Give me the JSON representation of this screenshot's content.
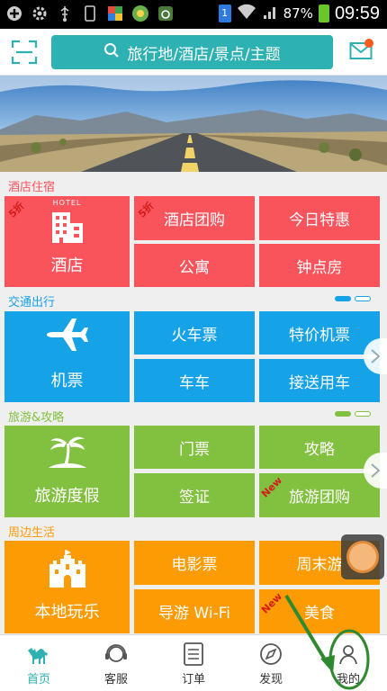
{
  "status_bar": {
    "battery_pct": "87%",
    "time": "09:59",
    "sim_badge": "1"
  },
  "header": {
    "search_placeholder": "旅行地/酒店/景点/主题"
  },
  "sections": {
    "hotel": {
      "title": "酒店住宿",
      "main": "酒店",
      "main_caption": "HOTEL",
      "main_badge": "5折",
      "items": [
        "酒店团购",
        "今日特惠",
        "公寓",
        "钟点房"
      ],
      "item_badge": "5折"
    },
    "transport": {
      "title": "交通出行",
      "main": "机票",
      "items": [
        "火车票",
        "特价机票",
        "车车",
        "接送用车"
      ]
    },
    "travel": {
      "title": "旅游&攻略",
      "main": "旅游度假",
      "items": [
        "门票",
        "攻略",
        "签证",
        "旅游团购"
      ],
      "new_badge": "New"
    },
    "local": {
      "title": "周边生活",
      "main": "本地玩乐",
      "items": [
        "电影票",
        "周末游",
        "导游 Wi-Fi",
        "美食"
      ],
      "new_badge": "New"
    }
  },
  "tabs": [
    {
      "label": "首页",
      "icon": "camel-icon"
    },
    {
      "label": "客服",
      "icon": "headset-icon"
    },
    {
      "label": "订单",
      "icon": "order-list-icon"
    },
    {
      "label": "发现",
      "icon": "compass-icon"
    },
    {
      "label": "我的",
      "icon": "profile-icon"
    }
  ],
  "colors": {
    "accent": "#2eb1b3",
    "hotel": "#f9535b",
    "transport": "#15a2e6",
    "travel": "#82c03f",
    "local": "#fd9b04",
    "annotation": "#2f8a2f"
  }
}
